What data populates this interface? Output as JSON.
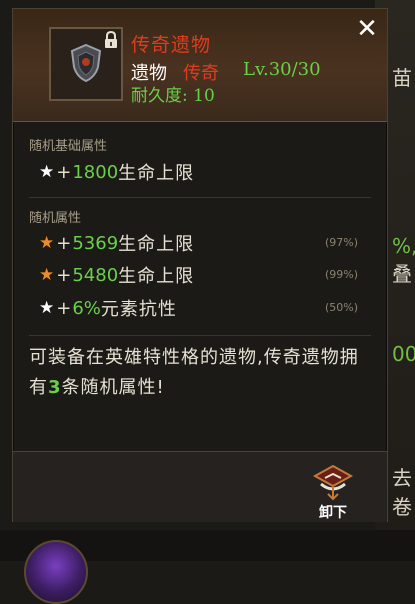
{
  "background": {
    "right_texts": [
      "苗",
      "%,",
      "叠",
      "00",
      "去卷"
    ],
    "right_text_color": "#d9d2c3"
  },
  "tooltip": {
    "close_icon": "close-icon",
    "item": {
      "name": "传奇遗物",
      "type": "遗物",
      "rarity": "传奇",
      "level": "Lv.30/30",
      "durability": "耐久度: 10",
      "icon": "shield-icon",
      "locked_icon": "lock-icon"
    },
    "base_section": {
      "title": "随机基础属性",
      "stats": [
        {
          "star": "★",
          "star_color": "#ffffff",
          "plus": "+",
          "value": "1800",
          "label": "生命上限",
          "percent": ""
        }
      ]
    },
    "random_section": {
      "title": "随机属性",
      "stats": [
        {
          "star": "★",
          "star_color": "#f08a24",
          "plus": "+",
          "value": "5369",
          "label": "生命上限",
          "percent": "(97%)"
        },
        {
          "star": "★",
          "star_color": "#f08a24",
          "plus": "+",
          "value": "5480",
          "label": "生命上限",
          "percent": "(99%)"
        },
        {
          "star": "★",
          "star_color": "#ffffff",
          "plus": "+",
          "value": "6%",
          "label": "元素抗性",
          "percent": "(50%)"
        }
      ]
    },
    "description": {
      "before": "可装备在英雄特性格的遗物,传奇遗物拥有",
      "highlight": "3",
      "after": "条随机属性!"
    },
    "footer": {
      "unequip_label": "卸下",
      "unequip_icon": "unequip-icon"
    },
    "colors": {
      "legendary_red": "#e23b1f",
      "value_green": "#6ad04a",
      "panel_bg": "#1b1a17"
    }
  }
}
